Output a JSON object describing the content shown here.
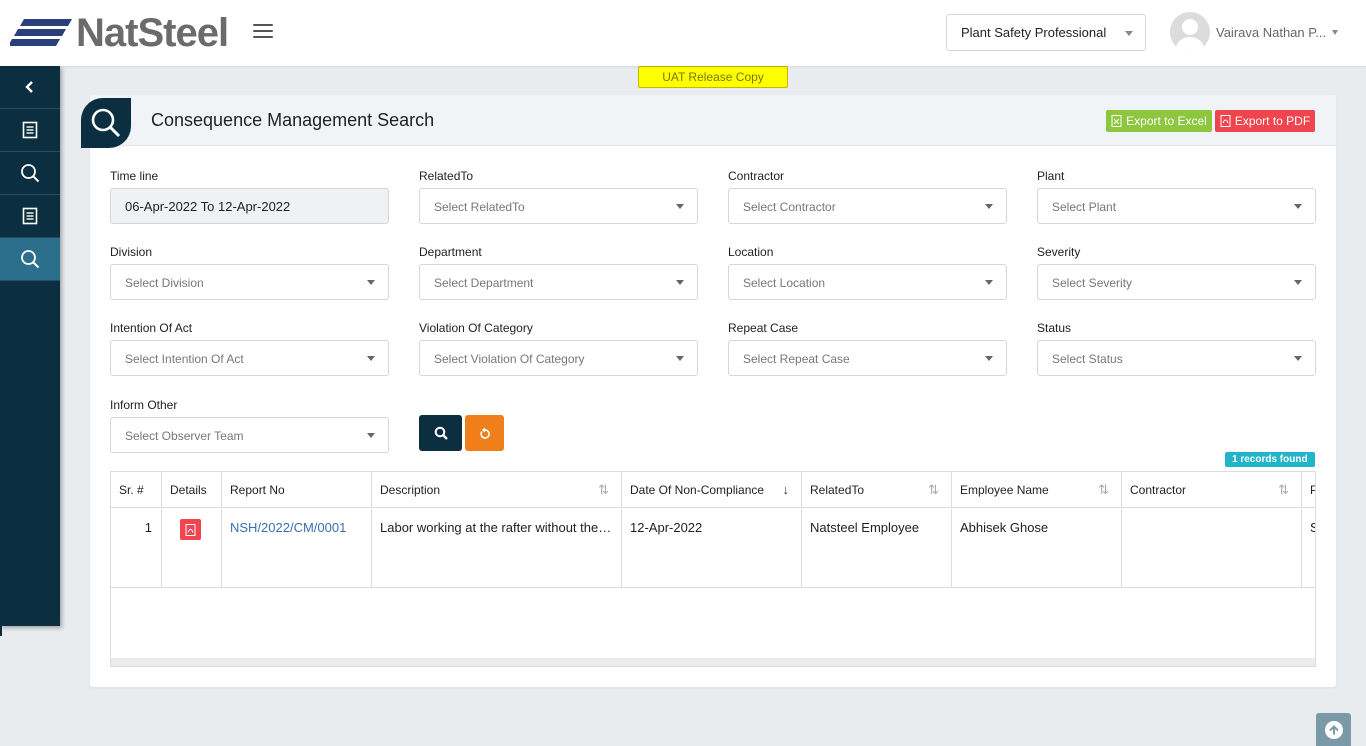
{
  "header": {
    "logo_text": "NatSteel",
    "role": "Plant Safety Professional",
    "user_name": "Vairava Nathan P..."
  },
  "uat_label": "UAT Release Copy",
  "sidebar": {
    "items": [
      {
        "icon": "chevron-left-icon",
        "active": false
      },
      {
        "icon": "document-icon",
        "active": false
      },
      {
        "icon": "search-icon",
        "active": false
      },
      {
        "icon": "document-icon",
        "active": false
      },
      {
        "icon": "search-icon",
        "active": true
      }
    ]
  },
  "panel": {
    "title": "Consequence Management Search",
    "export_excel": "Export to Excel",
    "export_pdf": "Export to PDF"
  },
  "filters": {
    "timeline": {
      "label": "Time line",
      "value": "06-Apr-2022 To 12-Apr-2022"
    },
    "related_to": {
      "label": "RelatedTo",
      "placeholder": "Select RelatedTo"
    },
    "contractor": {
      "label": "Contractor",
      "placeholder": "Select Contractor"
    },
    "plant": {
      "label": "Plant",
      "placeholder": "Select Plant"
    },
    "division": {
      "label": "Division",
      "placeholder": "Select Division"
    },
    "department": {
      "label": "Department",
      "placeholder": "Select Department"
    },
    "location": {
      "label": "Location",
      "placeholder": "Select Location"
    },
    "severity": {
      "label": "Severity",
      "placeholder": "Select Severity"
    },
    "intention": {
      "label": "Intention Of Act",
      "placeholder": "Select Intention Of Act"
    },
    "violation": {
      "label": "Violation Of Category",
      "placeholder": "Select Violation Of Category"
    },
    "repeat_case": {
      "label": "Repeat Case",
      "placeholder": "Select Repeat Case"
    },
    "status": {
      "label": "Status",
      "placeholder": "Select Status"
    },
    "inform_other": {
      "label": "Inform Other",
      "placeholder": "Select Observer Team"
    }
  },
  "records_found": "1 records found",
  "table": {
    "headers": [
      "Sr. #",
      "Details",
      "Report No",
      "Description",
      "Date Of Non-Compliance",
      "RelatedTo",
      "Employee Name",
      "Contractor",
      "P"
    ],
    "rows": [
      {
        "sr": "1",
        "report_no": "NSH/2022/CM/0001",
        "description": "Labor working at the rafter without the safety harness",
        "date": "12-Apr-2022",
        "related_to": "Natsteel Employee",
        "employee_name": "Abhisek Ghose",
        "contractor": "",
        "p": "S"
      }
    ]
  },
  "colors": {
    "sidebar_bg": "#0b2f40",
    "sidebar_active": "#2c6f8d",
    "excel_green": "#8dc63f",
    "pdf_red": "#f0444e",
    "reset_orange": "#f07f1b",
    "badge_teal": "#22b4c8",
    "uat_yellow": "#ffff00"
  }
}
